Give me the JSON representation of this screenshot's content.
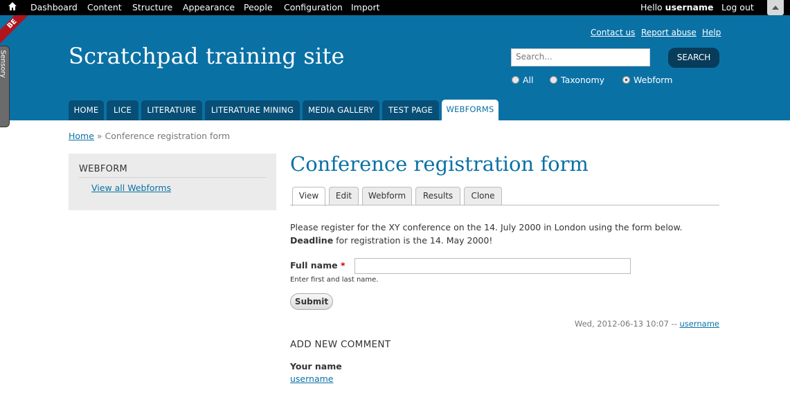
{
  "toolbar": {
    "items": [
      "Dashboard",
      "Content",
      "Structure",
      "Appearance",
      "People",
      "Configuration",
      "Import"
    ],
    "hello_prefix": "Hello",
    "username": "username",
    "logout": "Log out"
  },
  "header": {
    "corner_badge": "BE",
    "side_tab": "Sensory",
    "site_name": "Scratchpad training site",
    "secondary_links": [
      "Contact us",
      "Report abuse",
      "Help"
    ],
    "search_placeholder": "Search...",
    "search_button": "SEARCH",
    "search_scopes": [
      "All",
      "Taxonomy",
      "Webform"
    ],
    "search_scope_selected": "Webform"
  },
  "primary_tabs": [
    "HOME",
    "LICE",
    "LITERATURE",
    "LITERATURE MINING",
    "MEDIA GALLERY",
    "TEST PAGE",
    "WEBFORMS"
  ],
  "primary_tab_active": "WEBFORMS",
  "breadcrumb": {
    "home": "Home",
    "separator": "»",
    "current": "Conference registration form"
  },
  "sidebar": {
    "title": "WEBFORM",
    "link": "View all Webforms"
  },
  "main": {
    "title": "Conference registration form",
    "tabs": [
      "View",
      "Edit",
      "Webform",
      "Results",
      "Clone"
    ],
    "active_tab": "View",
    "intro_line1": "Please register for the XY conference on the 14. July 2000 in London using the form  below.",
    "deadline_label": "Deadline",
    "intro_line2_rest": " for registration is the 14. May  2000!",
    "field_label": "Full name",
    "required_marker": "*",
    "field_description": "Enter first and last name.",
    "submit_label": "Submit",
    "submitted_date": "Wed, 2012-06-13 10:07 --",
    "submitted_user": "username",
    "comment_heading": "ADD NEW COMMENT",
    "your_name_label": "Your name",
    "your_name_value": "username"
  },
  "colors": {
    "header_blue": "#0a71a5",
    "tab_dark": "#074f76",
    "toolbar": "#000000",
    "required": "#cc0000"
  }
}
